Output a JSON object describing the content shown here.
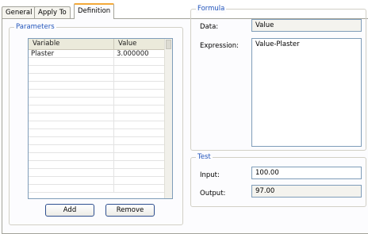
{
  "tabs": [
    "General",
    "Apply To",
    "Definition"
  ],
  "parameters": {
    "legend": "Parameters",
    "columns": [
      "Variable",
      "Value"
    ],
    "rows": [
      {
        "variable": "Plaster",
        "value": "3.000000"
      }
    ],
    "add_label": "Add",
    "remove_label": "Remove"
  },
  "formula": {
    "legend": "Formula",
    "data_label": "Data:",
    "data_value": "Value",
    "expression_label": "Expression:",
    "expression_value": "Value-Plaster"
  },
  "test": {
    "legend": "Test",
    "input_label": "Input:",
    "input_value": "100.00",
    "output_label": "Output:",
    "output_value": "97.00"
  },
  "colors": {
    "accent_tab": "#f3a93a",
    "legend_text": "#2255bb"
  }
}
